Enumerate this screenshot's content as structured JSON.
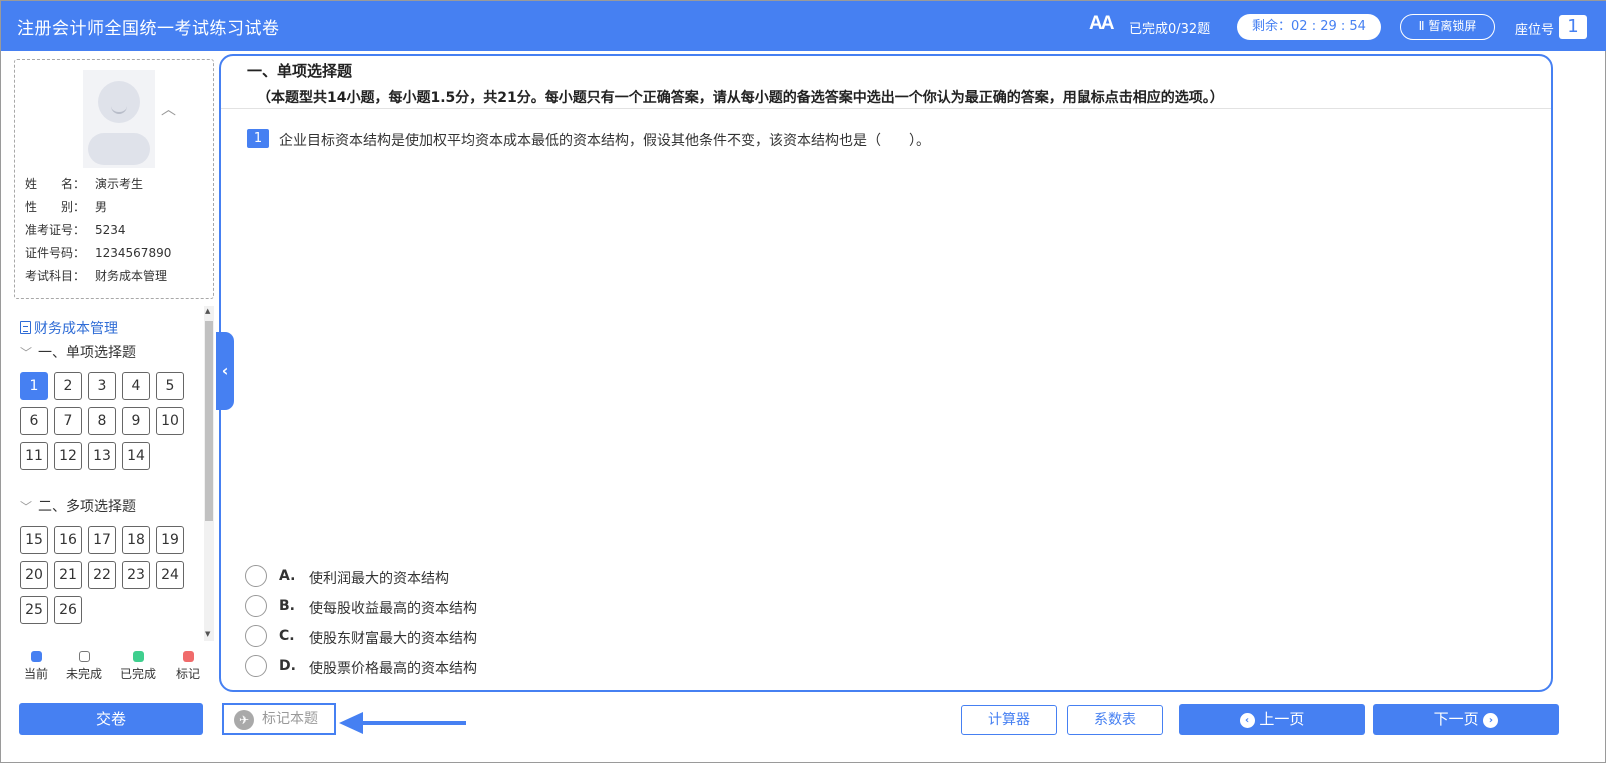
{
  "header": {
    "title": "注册会计师全国统一考试练习试卷",
    "font_icon": "AA",
    "progress": "已完成0/32题",
    "timer": "剩余：02 : 29 : 54",
    "pause": "Ⅱ 暂离锁屏",
    "seat_label": "座位号",
    "seat_number": "1"
  },
  "profile": {
    "rows": [
      {
        "label": "姓　　名：",
        "value": "演示考生"
      },
      {
        "label": "性　　别：",
        "value": "男"
      },
      {
        "label": "准考证号：",
        "value": "5234"
      },
      {
        "label": "证件号码：",
        "value": "1234567890"
      },
      {
        "label": "考试科目：",
        "value": "财务成本管理"
      }
    ]
  },
  "nav": {
    "subject": "财务成本管理",
    "sections": [
      {
        "title": "一、单项选择题",
        "questions": [
          "1",
          "2",
          "3",
          "4",
          "5",
          "6",
          "7",
          "8",
          "9",
          "10",
          "11",
          "12",
          "13",
          "14"
        ]
      },
      {
        "title": "二、多项选择题",
        "questions": [
          "15",
          "16",
          "17",
          "18",
          "19",
          "20",
          "21",
          "22",
          "23",
          "24",
          "25",
          "26"
        ]
      }
    ],
    "current": "1"
  },
  "legend": [
    {
      "label": "当前",
      "color": "#4680f2"
    },
    {
      "label": "未完成",
      "color": "#ffffff"
    },
    {
      "label": "已完成",
      "color": "#3fcf8e"
    },
    {
      "label": "标记",
      "color": "#f06b6b"
    }
  ],
  "main": {
    "section_title": "一、单项选择题",
    "section_desc": "（本题型共14小题，每小题1.5分，共21分。每小题只有一个正确答案，请从每小题的备选答案中选出一个你认为最正确的答案，用鼠标点击相应的选项。）",
    "question_number": "1",
    "question_text": "企业目标资本结构是使加权平均资本成本最低的资本结构，假设其他条件不变，该资本结构也是（　　）。",
    "options": [
      {
        "letter": "A.",
        "text": "使利润最大的资本结构"
      },
      {
        "letter": "B.",
        "text": "使每股收益最高的资本结构"
      },
      {
        "letter": "C.",
        "text": "使股东财富最大的资本结构"
      },
      {
        "letter": "D.",
        "text": "使股票价格最高的资本结构"
      }
    ]
  },
  "footer": {
    "submit": "交卷",
    "flag": "标记本题",
    "calculator": "计算器",
    "coef_table": "系数表",
    "prev": "上一页",
    "next": "下一页"
  }
}
